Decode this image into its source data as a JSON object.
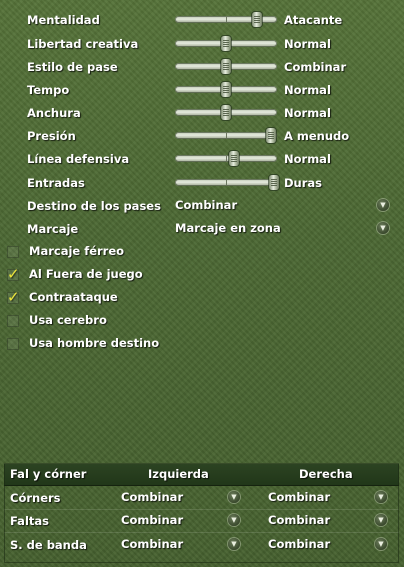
{
  "sliders": [
    {
      "label": "Mentalidad",
      "value": "Atacante",
      "level": 0.8
    },
    {
      "label": "Libertad creativa",
      "value": "Normal",
      "level": 0.5
    },
    {
      "label": "Estilo de pase",
      "value": "Combinar",
      "level": 0.5
    },
    {
      "label": "Tempo",
      "value": "Normal",
      "level": 0.5
    },
    {
      "label": "Anchura",
      "value": "Normal",
      "level": 0.5
    },
    {
      "label": "Presión",
      "value": "A menudo",
      "level": 0.94
    },
    {
      "label": "Línea defensiva",
      "value": "Normal",
      "level": 0.58
    },
    {
      "label": "Entradas",
      "value": "Duras",
      "level": 0.97
    }
  ],
  "dropdowns": [
    {
      "label": "Destino de los pases",
      "value": "Combinar"
    },
    {
      "label": "Marcaje",
      "value": "Marcaje en zona"
    }
  ],
  "checkboxes": [
    {
      "label": "Marcaje férreo",
      "checked": false
    },
    {
      "label": "Al Fuera de juego",
      "checked": true
    },
    {
      "label": "Contraataque",
      "checked": true
    },
    {
      "label": "Usa cerebro",
      "checked": false
    },
    {
      "label": "Usa hombre destino",
      "checked": false
    }
  ],
  "set_pieces": {
    "header": {
      "col1": "Fal y córner",
      "col2": "Izquierda",
      "col3": "Derecha"
    },
    "rows": [
      {
        "label": "Córners",
        "left": "Combinar",
        "right": "Combinar"
      },
      {
        "label": "Faltas",
        "left": "Combinar",
        "right": "Combinar"
      },
      {
        "label": "S. de banda",
        "left": "Combinar",
        "right": "Combinar"
      }
    ]
  },
  "colors": {
    "checkmark": "#ece43a",
    "background": "#4e6a35"
  },
  "icons": {
    "dropdown": "chevron-down-icon",
    "checkmark": "checkmark-icon"
  }
}
